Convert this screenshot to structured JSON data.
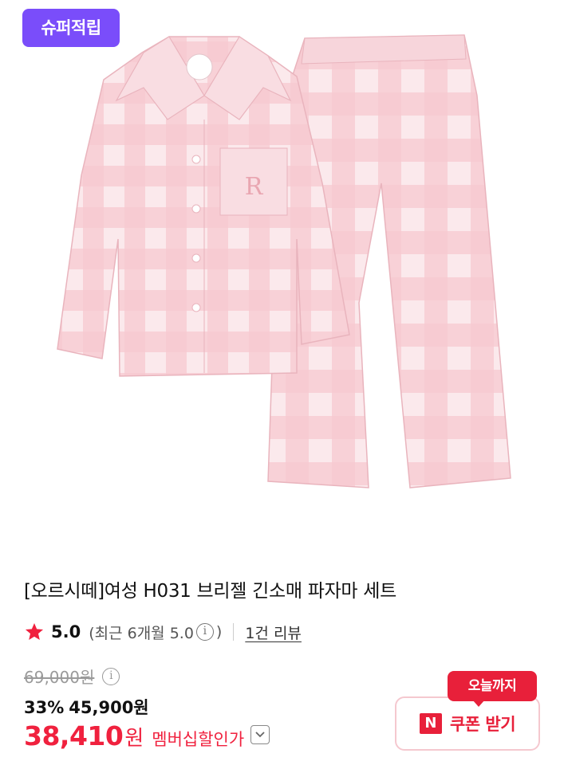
{
  "badge": {
    "label": "슈퍼적립",
    "color": "#7a4dfa"
  },
  "product_image": {
    "description_icon": "pajama-set-image"
  },
  "product": {
    "title": "[오르시떼]여성 H031 브리젤 긴소매 파자마 세트"
  },
  "rating": {
    "icon": "star-icon",
    "score": "5.0",
    "recent_text": "(최근 6개월 5.0",
    "info_symbol": "i",
    "close_paren": ")",
    "review_link": "1건 리뷰"
  },
  "price": {
    "original": "69,000원",
    "info_symbol": "i",
    "discount_rate": "33%",
    "sale_price": "45,900원",
    "member_price": "38,410",
    "member_unit": "원",
    "member_label": "멤버십할인가",
    "accent_color": "#f0213e"
  },
  "coupon": {
    "tag": "오늘까지",
    "logo_letter": "N",
    "label": "쿠폰 받기"
  }
}
